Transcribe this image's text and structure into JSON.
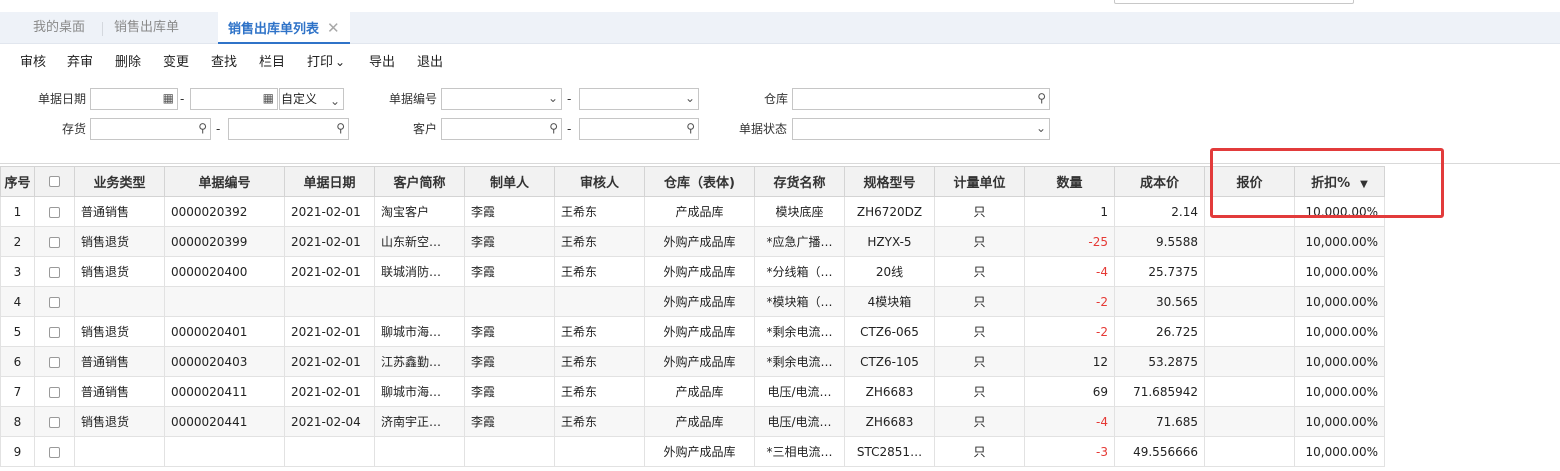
{
  "tabs": [
    {
      "label": "我的桌面"
    },
    {
      "label": "销售出库单"
    },
    {
      "label": "销售出库单列表",
      "close": "✕"
    }
  ],
  "toolbar": [
    "审核",
    "弃审",
    "删除",
    "变更",
    "查找",
    "栏目",
    "打印",
    "导出",
    "退出"
  ],
  "toolbar_print_caret": "⌄",
  "filters": {
    "doc_date": "单据日期",
    "date_mode": "自定义",
    "doc_no": "单据编号",
    "warehouse": "仓库",
    "inventory": "存货",
    "customer": "客户",
    "doc_status": "单据状态",
    "dash": "-"
  },
  "columns": [
    "序号",
    "",
    "业务类型",
    "单据编号",
    "单据日期",
    "客户简称",
    "制单人",
    "审核人",
    "仓库（表体)",
    "存货名称",
    "规格型号",
    "计量单位",
    "数量",
    "成本价",
    "报价",
    "折扣%"
  ],
  "rows": [
    {
      "idx": "1",
      "type": "普通销售",
      "no": "0000020392",
      "date": "2021-02-01",
      "cust": "淘宝客户",
      "maker": "李霞",
      "auditor": "王希东",
      "wh": "产成品库",
      "item": "模块底座",
      "spec": "ZH6720DZ",
      "unit": "只",
      "qty": "1",
      "cost": "2.14",
      "quote": "",
      "disc": "10,000.00%"
    },
    {
      "idx": "2",
      "type": "销售退货",
      "no": "0000020399",
      "date": "2021-02-01",
      "cust": "山东新空…",
      "maker": "李霞",
      "auditor": "王希东",
      "wh": "外购产成品库",
      "item": "*应急广播…",
      "spec": "HZYX-5",
      "unit": "只",
      "qty": "-25",
      "cost": "9.5588",
      "quote": "",
      "disc": "10,000.00%"
    },
    {
      "idx": "3",
      "type": "销售退货",
      "no": "0000020400",
      "date": "2021-02-01",
      "cust": "联城消防…",
      "maker": "李霞",
      "auditor": "王希东",
      "wh": "外购产成品库",
      "item": "*分线箱（…",
      "spec": "20线",
      "unit": "只",
      "qty": "-4",
      "cost": "25.7375",
      "quote": "",
      "disc": "10,000.00%"
    },
    {
      "idx": "4",
      "type": "",
      "no": "",
      "date": "",
      "cust": "",
      "maker": "",
      "auditor": "",
      "wh": "外购产成品库",
      "item": "*模块箱（…",
      "spec": "4模块箱",
      "unit": "只",
      "qty": "-2",
      "cost": "30.565",
      "quote": "",
      "disc": "10,000.00%"
    },
    {
      "idx": "5",
      "type": "销售退货",
      "no": "0000020401",
      "date": "2021-02-01",
      "cust": "聊城市海…",
      "maker": "李霞",
      "auditor": "王希东",
      "wh": "外购产成品库",
      "item": "*剩余电流…",
      "spec": "CTZ6-065",
      "unit": "只",
      "qty": "-2",
      "cost": "26.725",
      "quote": "",
      "disc": "10,000.00%"
    },
    {
      "idx": "6",
      "type": "普通销售",
      "no": "0000020403",
      "date": "2021-02-01",
      "cust": "江苏鑫勤…",
      "maker": "李霞",
      "auditor": "王希东",
      "wh": "外购产成品库",
      "item": "*剩余电流…",
      "spec": "CTZ6-105",
      "unit": "只",
      "qty": "12",
      "cost": "53.2875",
      "quote": "",
      "disc": "10,000.00%"
    },
    {
      "idx": "7",
      "type": "普通销售",
      "no": "0000020411",
      "date": "2021-02-01",
      "cust": "聊城市海…",
      "maker": "李霞",
      "auditor": "王希东",
      "wh": "产成品库",
      "item": "电压/电流…",
      "spec": "ZH6683",
      "unit": "只",
      "qty": "69",
      "cost": "71.685942",
      "quote": "",
      "disc": "10,000.00%"
    },
    {
      "idx": "8",
      "type": "销售退货",
      "no": "0000020441",
      "date": "2021-02-04",
      "cust": "济南宇正…",
      "maker": "李霞",
      "auditor": "王希东",
      "wh": "产成品库",
      "item": "电压/电流…",
      "spec": "ZH6683",
      "unit": "只",
      "qty": "-4",
      "cost": "71.685",
      "quote": "",
      "disc": "10,000.00%"
    },
    {
      "idx": "9",
      "type": "",
      "no": "",
      "date": "",
      "cust": "",
      "maker": "",
      "auditor": "",
      "wh": "外购产成品库",
      "item": "*三相电流…",
      "spec": "STC2851…",
      "unit": "只",
      "qty": "-3",
      "cost": "49.556666",
      "quote": "",
      "disc": "10,000.00%"
    }
  ],
  "colors": {
    "accent": "#2f73c8",
    "negative": "#e53935",
    "highlight": "#e23b3b"
  }
}
